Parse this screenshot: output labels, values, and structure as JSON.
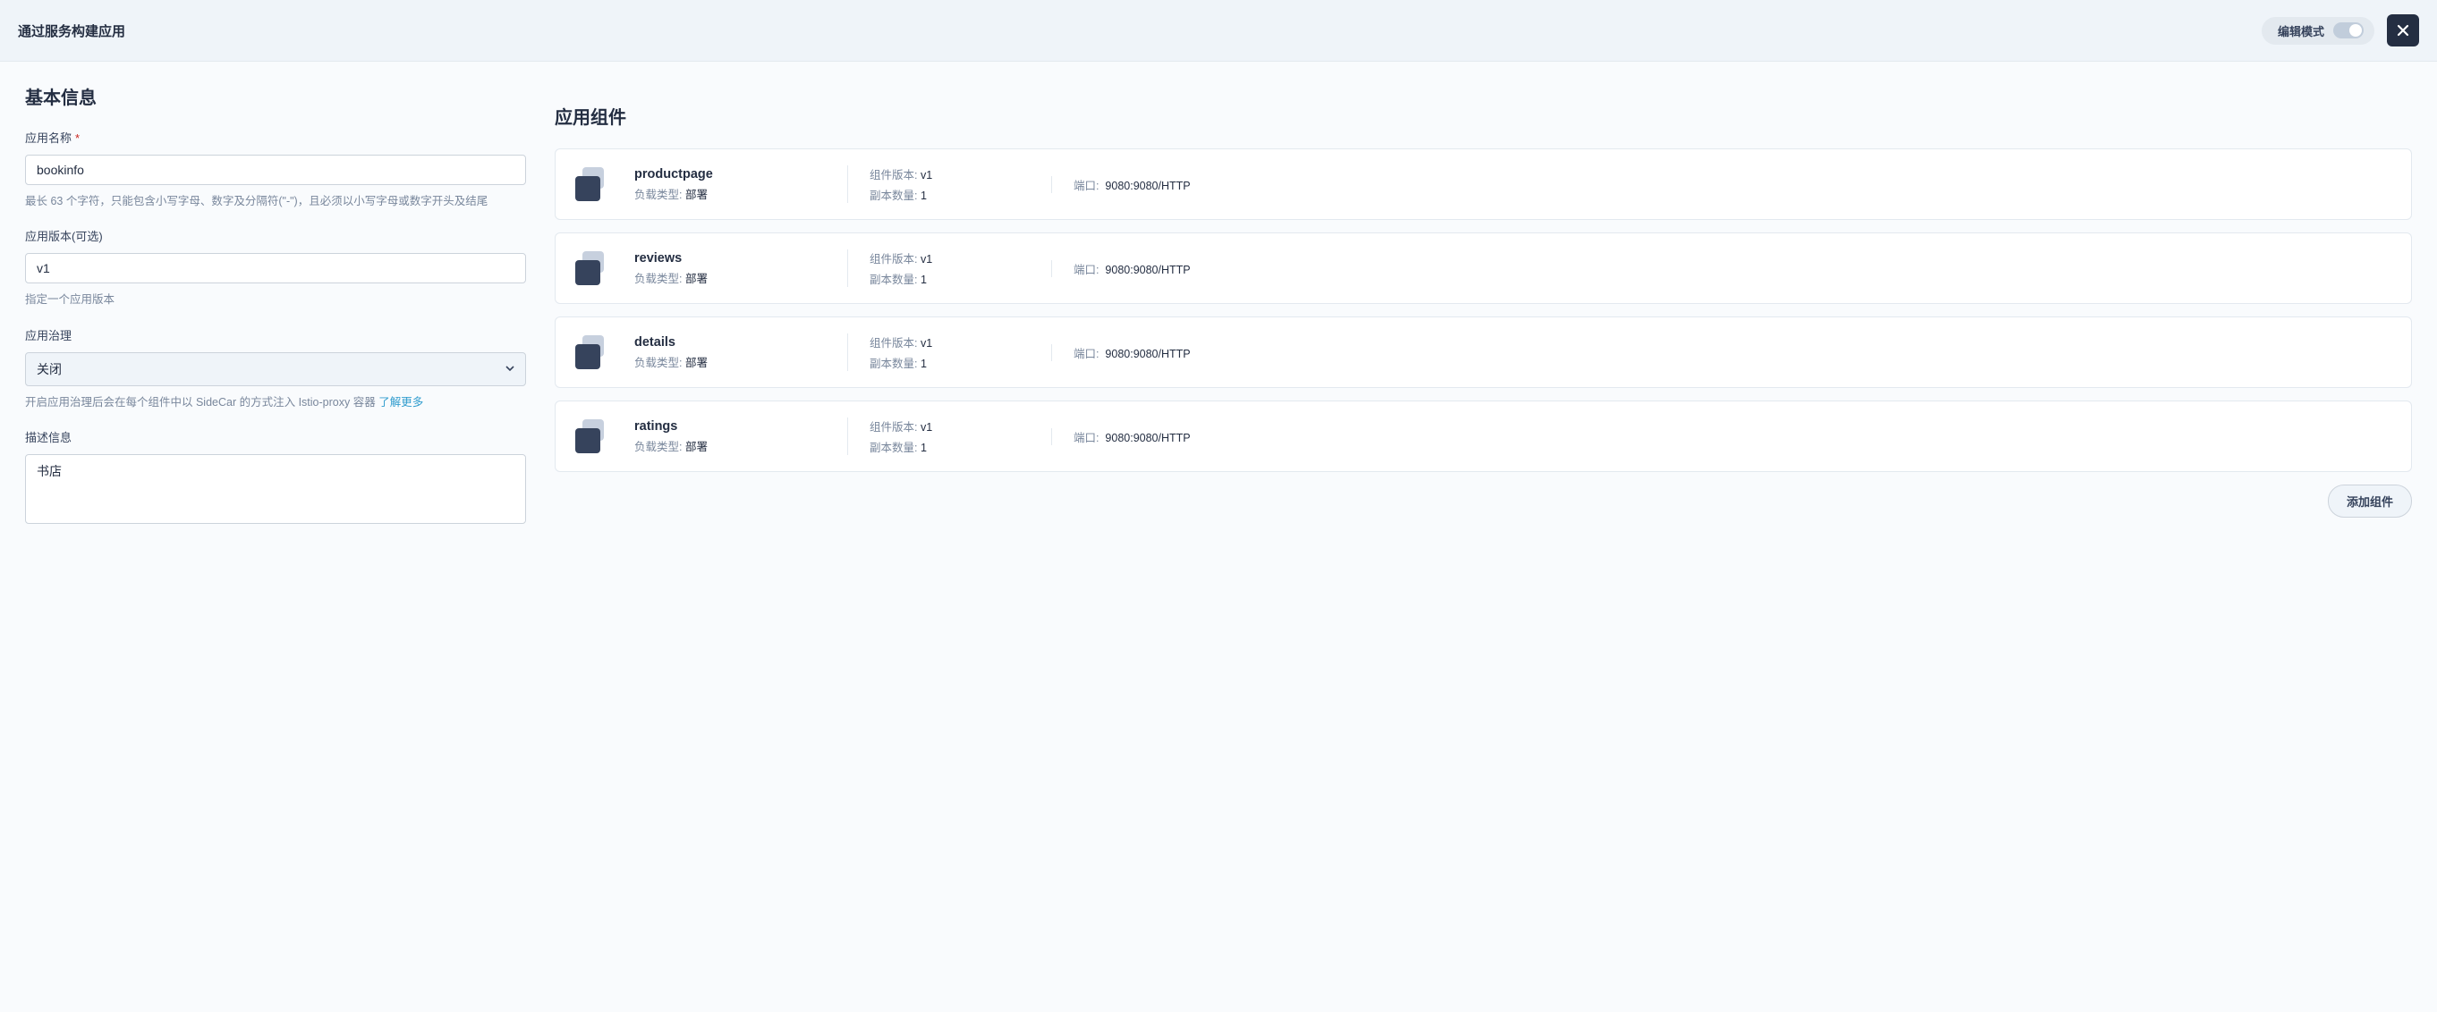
{
  "header": {
    "title": "通过服务构建应用",
    "edit_mode_label": "编辑模式"
  },
  "basic": {
    "section_title": "基本信息",
    "name_label": "应用名称",
    "name_value": "bookinfo",
    "name_help": "最长 63 个字符，只能包含小写字母、数字及分隔符(\"-\")，且必须以小写字母或数字开头及结尾",
    "version_label": "应用版本(可选)",
    "version_value": "v1",
    "version_help": "指定一个应用版本",
    "governance_label": "应用治理",
    "governance_value": "关闭",
    "governance_help_text": "开启应用治理后会在每个组件中以 SideCar 的方式注入 Istio-proxy 容器 ",
    "governance_learn_more": "了解更多",
    "desc_label": "描述信息",
    "desc_value": "书店"
  },
  "components": {
    "section_title": "应用组件",
    "workload_type_label": "负载类型",
    "version_label": "组件版本",
    "replicas_label": "副本数量",
    "port_label": "端口",
    "add_button": "添加组件",
    "items": [
      {
        "name": "productpage",
        "workload_type": "部署",
        "version": "v1",
        "replicas": "1",
        "port": "9080:9080/HTTP"
      },
      {
        "name": "reviews",
        "workload_type": "部署",
        "version": "v1",
        "replicas": "1",
        "port": "9080:9080/HTTP"
      },
      {
        "name": "details",
        "workload_type": "部署",
        "version": "v1",
        "replicas": "1",
        "port": "9080:9080/HTTP"
      },
      {
        "name": "ratings",
        "workload_type": "部署",
        "version": "v1",
        "replicas": "1",
        "port": "9080:9080/HTTP"
      }
    ]
  }
}
